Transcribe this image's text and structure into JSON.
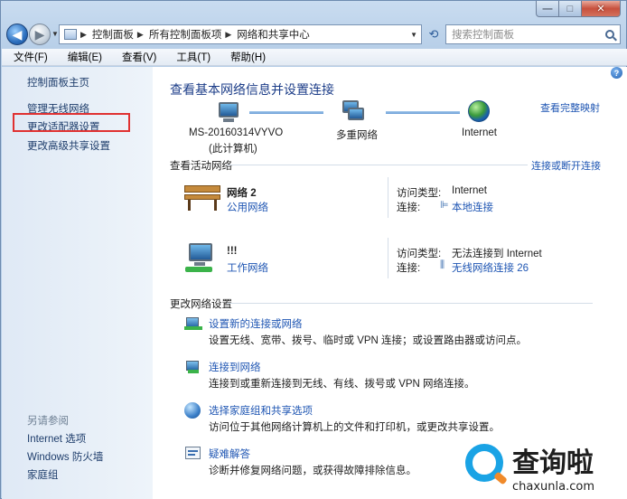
{
  "window": {
    "address": {
      "crumbs": [
        "控制面板",
        "所有控制面板项",
        "网络和共享中心"
      ]
    },
    "search_placeholder": "搜索控制面板"
  },
  "menu": [
    "文件(F)",
    "编辑(E)",
    "查看(V)",
    "工具(T)",
    "帮助(H)"
  ],
  "sidebar": {
    "home": "控制面板主页",
    "links": [
      "管理无线网络",
      "更改适配器设置",
      "更改高级共享设置"
    ],
    "see_also_title": "另请参阅",
    "see_also": [
      "Internet 选项",
      "Windows 防火墙",
      "家庭组"
    ]
  },
  "main": {
    "title": "查看基本网络信息并设置连接",
    "full_map": "查看完整映射",
    "map": {
      "computer_name": "MS-20160314VYVO",
      "computer_sub": "(此计算机)",
      "middle": "多重网络",
      "right": "Internet"
    },
    "active_title": "查看活动网络",
    "connect_disconnect": "连接或断开连接",
    "networks": [
      {
        "name": "网络  2",
        "type": "公用网络",
        "access_label": "访问类型:",
        "access_value": "Internet",
        "conn_label": "连接:",
        "conn_value": "本地连接"
      },
      {
        "name": "!!!",
        "type": "工作网络",
        "access_label": "访问类型:",
        "access_value": "无法连接到 Internet",
        "conn_label": "连接:",
        "conn_value": "无线网络连接 26"
      }
    ],
    "change_title": "更改网络设置",
    "tasks": [
      {
        "title": "设置新的连接或网络",
        "desc": "设置无线、宽带、拨号、临时或 VPN 连接；或设置路由器或访问点。"
      },
      {
        "title": "连接到网络",
        "desc": "连接到或重新连接到无线、有线、拨号或 VPN 网络连接。"
      },
      {
        "title": "选择家庭组和共享选项",
        "desc": "访问位于其他网络计算机上的文件和打印机，或更改共享设置。"
      },
      {
        "title": "疑难解答",
        "desc": "诊断并修复网络问题，或获得故障排除信息。"
      }
    ]
  },
  "watermark": {
    "text": "查询啦",
    "url": "chaxunla.com"
  }
}
